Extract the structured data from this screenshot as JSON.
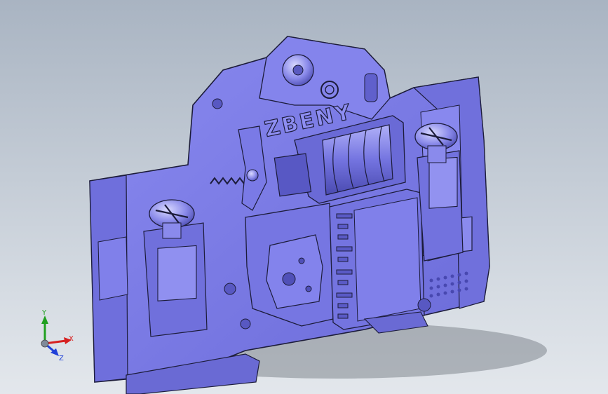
{
  "viewport": {
    "background_top": "#a9b4c2",
    "background_bottom": "#e3e7ec"
  },
  "model": {
    "body_color": "#7b7be8",
    "shade_color": "#5c5cc8",
    "highlight_color": "#9a9af2",
    "edge_color": "#1c1c3a",
    "brand_text": "ZBENY"
  },
  "triad": {
    "x_label": "X",
    "y_label": "Y",
    "z_label": "Z",
    "x_color": "#d62020",
    "y_color": "#20a020",
    "z_color": "#2040d8"
  }
}
